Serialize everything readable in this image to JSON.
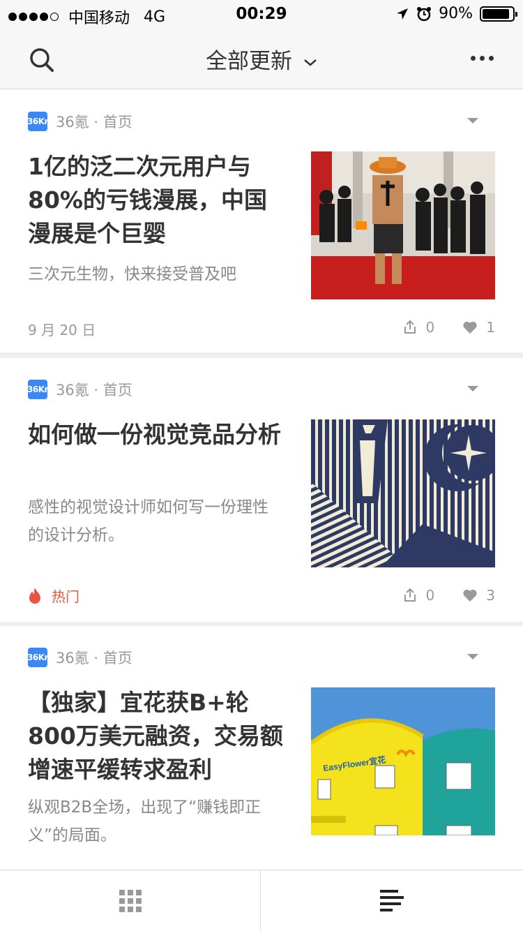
{
  "status_bar": {
    "carrier": "中国移动",
    "network": "4G",
    "time": "00:29",
    "battery_text": "90%",
    "battery_level": 0.9
  },
  "header": {
    "title": "全部更新",
    "icons": {
      "search": "search-icon",
      "dropdown": "chevron-down-icon",
      "more": "more-icon"
    }
  },
  "articles": [
    {
      "logo_text": "36Kr",
      "source": "36氪 · 首页",
      "title": "1亿的泛二次元用户与80%的亏钱漫展，中国漫展是个巨婴",
      "summary": "三次元生物，快来接受普及吧",
      "date": "9 月 20 日",
      "shares": "0",
      "likes": "1"
    },
    {
      "logo_text": "36Kr",
      "source": "36氪 · 首页",
      "title": "如何做一份视觉竞品分析",
      "summary": "感性的视觉设计师如何写一份理性的设计分析。",
      "tag": "热门",
      "shares": "0",
      "likes": "3"
    },
    {
      "logo_text": "36Kr",
      "source": "36氪 · 首页",
      "title": "【独家】宜花获B+轮800万美元融资，交易额增速平缓转求盈利",
      "summary": "纵观B2B全场，出现了“赚钱即正义”的局面。",
      "thumb_sign": "EasyFlower宜花"
    }
  ],
  "tab_bar": {
    "left_icon": "grid-icon",
    "right_icon": "list-icon"
  },
  "colors": {
    "brand_blue": "#3b88f5",
    "hot_red": "#e8543f",
    "text_dark": "#333333",
    "text_gray": "#999999"
  }
}
